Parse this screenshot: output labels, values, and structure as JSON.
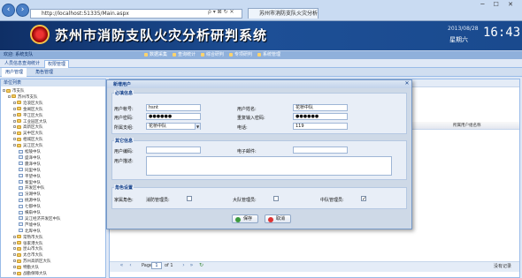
{
  "browser": {
    "address": "http://localhost:51335/Main.aspx",
    "tab_title": "苏州市消防支队火灾分析研...",
    "address_icons": "ρ ▾ ⊠ ↻ ✕"
  },
  "app": {
    "title": "苏州市消防支队火灾分析研判系统",
    "date": "2013/08/28",
    "weekday": "星期六",
    "clock": "16:43",
    "welcome": "欢迎: 系统支队"
  },
  "menu": [
    "数据采集",
    "查询统计",
    "综合研判",
    "专项研判",
    "系统管理"
  ],
  "page_tabs": [
    "人员信息查询统计",
    "权限管理"
  ],
  "sub_tabs": [
    "用户管理",
    "角色管理"
  ],
  "tree": {
    "header": "单位列表",
    "nodes": [
      {
        "label": "市支队",
        "type": "folder",
        "level": 0
      },
      {
        "label": "苏州市支队",
        "type": "folder",
        "level": 1
      },
      {
        "label": "沧浪区大队",
        "type": "folder",
        "level": 2
      },
      {
        "label": "金阊区大队",
        "type": "folder",
        "level": 2
      },
      {
        "label": "平江区大队",
        "type": "folder",
        "level": 2
      },
      {
        "label": "工业园区大队",
        "type": "folder",
        "level": 2
      },
      {
        "label": "高新区大队",
        "type": "folder",
        "level": 2
      },
      {
        "label": "吴中区大队",
        "type": "folder",
        "level": 2
      },
      {
        "label": "相城区大队",
        "type": "folder",
        "level": 2
      },
      {
        "label": "吴江区大队",
        "type": "folder",
        "level": 2
      },
      {
        "label": "松陵中队",
        "type": "leaf",
        "level": 3
      },
      {
        "label": "盛泽中队",
        "type": "leaf",
        "level": 3
      },
      {
        "label": "震泽中队",
        "type": "leaf",
        "level": 3
      },
      {
        "label": "同里中队",
        "type": "leaf",
        "level": 3
      },
      {
        "label": "平望中队",
        "type": "leaf",
        "level": 3
      },
      {
        "label": "黎里中队",
        "type": "leaf",
        "level": 3
      },
      {
        "label": "开发区中队",
        "type": "leaf",
        "level": 3
      },
      {
        "label": "汾湖中队",
        "type": "leaf",
        "level": 3
      },
      {
        "label": "桃源中队",
        "type": "leaf",
        "level": 3
      },
      {
        "label": "七都中队",
        "type": "leaf",
        "level": 3
      },
      {
        "label": "横扇中队",
        "type": "leaf",
        "level": 3
      },
      {
        "label": "吴江经济开发区中队",
        "type": "leaf",
        "level": 3
      },
      {
        "label": "芦墟中队",
        "type": "leaf",
        "level": 3
      },
      {
        "label": "北厍中队",
        "type": "leaf",
        "level": 3
      },
      {
        "label": "常熟市大队",
        "type": "folder",
        "level": 2
      },
      {
        "label": "张家港大队",
        "type": "folder",
        "level": 2
      },
      {
        "label": "昆山市大队",
        "type": "folder",
        "level": 2
      },
      {
        "label": "太仓市大队",
        "type": "folder",
        "level": 2
      },
      {
        "label": "苏州高新区大队",
        "type": "folder",
        "level": 2
      },
      {
        "label": "特勤大队",
        "type": "folder",
        "level": 2
      },
      {
        "label": "战勤保障大队",
        "type": "folder",
        "level": 2
      }
    ]
  },
  "grid": {
    "last_column": "所属用户组名称",
    "pager_label": "Page",
    "pager_page": "1",
    "pager_of": "of 1",
    "no_data": "没有记录"
  },
  "dialog": {
    "title": "新增用户",
    "close_icon": "✕",
    "section_required": "必填信息",
    "section_other": "其它信息",
    "section_roles": "角色设置",
    "fields": {
      "account_label": "用户帐号:",
      "account_value": "hsnt",
      "name_label": "用户姓名:",
      "name_value": "花桥中队",
      "password_label": "用户密码:",
      "password_value": "●●●●●●",
      "password_confirm_label": "重复输入密码:",
      "password_confirm_value": "●●●●●●",
      "unit_label": "所属支组:",
      "unit_value": "花桥中队",
      "phone_label": "电话:",
      "phone_value": "119",
      "code_label": "用户编码:",
      "code_value": "",
      "email_label": "电子邮件:",
      "email_value": "",
      "desc_label": "用户描述:",
      "desc_value": ""
    },
    "roles": {
      "label": "家属角色:",
      "items": [
        {
          "label": "消防管理员:",
          "checked": false
        },
        {
          "label": "大队管理员:",
          "checked": false
        },
        {
          "label": "中队管理员:",
          "checked": true
        }
      ]
    },
    "save_label": "保存",
    "cancel_label": "取消"
  },
  "colors": {
    "banner": "#1d4f96",
    "panel_border": "#99bbe8",
    "dialog_bg": "#ced9e7",
    "accent_title": "#15428b"
  }
}
